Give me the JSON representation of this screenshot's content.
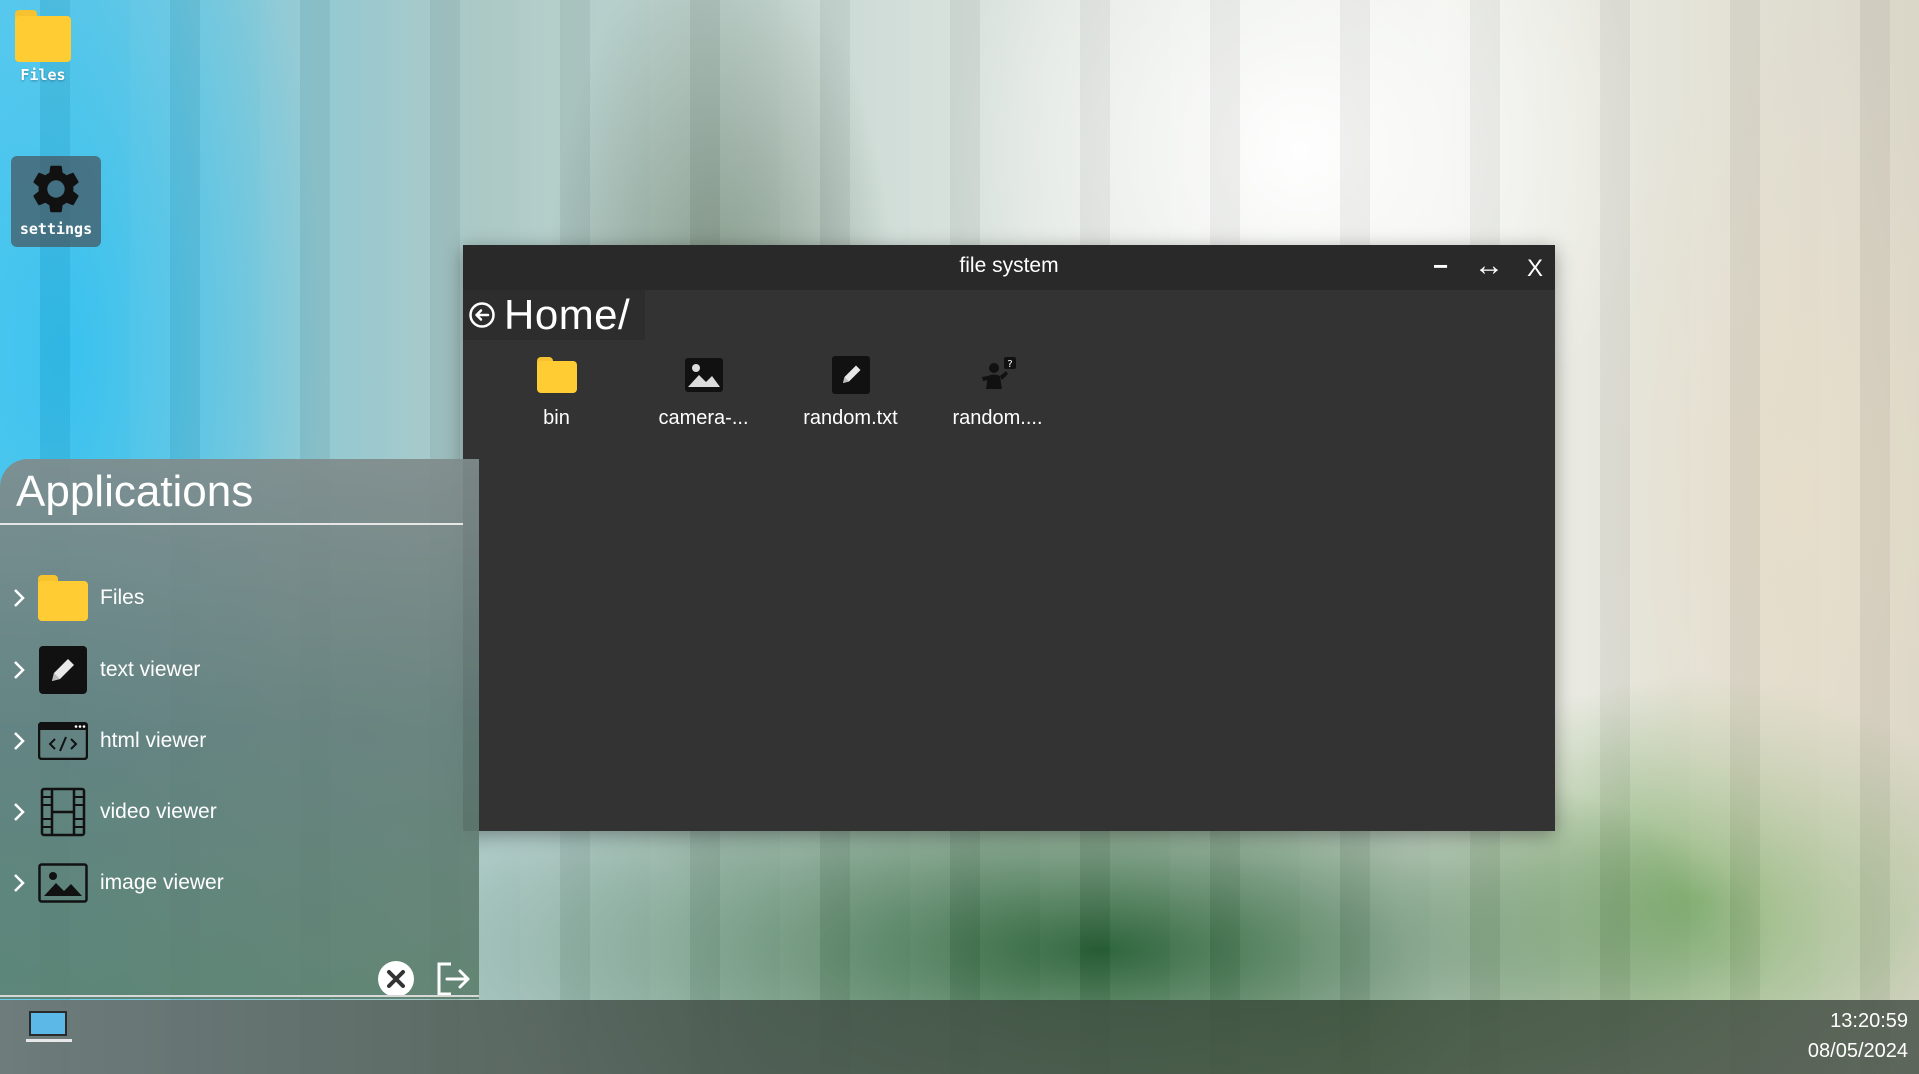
{
  "desktop": {
    "icons": [
      {
        "label": "Files",
        "icon": "folder-icon"
      },
      {
        "label": "settings",
        "icon": "gear-icon"
      }
    ]
  },
  "window": {
    "title": "file system",
    "minimize_label": "−",
    "maximize_label": "↔",
    "close_label": "X",
    "path": "Home/",
    "files": [
      {
        "name": "bin",
        "icon": "folder-icon"
      },
      {
        "name": "camera-...",
        "icon": "image-file-icon"
      },
      {
        "name": "random.txt",
        "icon": "text-file-icon"
      },
      {
        "name": "random....",
        "icon": "unknown-file-icon"
      }
    ]
  },
  "applications": {
    "title": "Applications",
    "items": [
      {
        "label": "Files",
        "icon": "folder-icon"
      },
      {
        "label": "text viewer",
        "icon": "pencil-icon"
      },
      {
        "label": "html viewer",
        "icon": "code-window-icon"
      },
      {
        "label": "video viewer",
        "icon": "film-icon"
      },
      {
        "label": "image viewer",
        "icon": "picture-icon"
      }
    ]
  },
  "taskbar": {
    "time": "13:20:59",
    "date": "08/05/2024"
  },
  "colors": {
    "window_bg": "#333333",
    "titlebar_bg": "#292929",
    "folder": "#ffcc33"
  }
}
